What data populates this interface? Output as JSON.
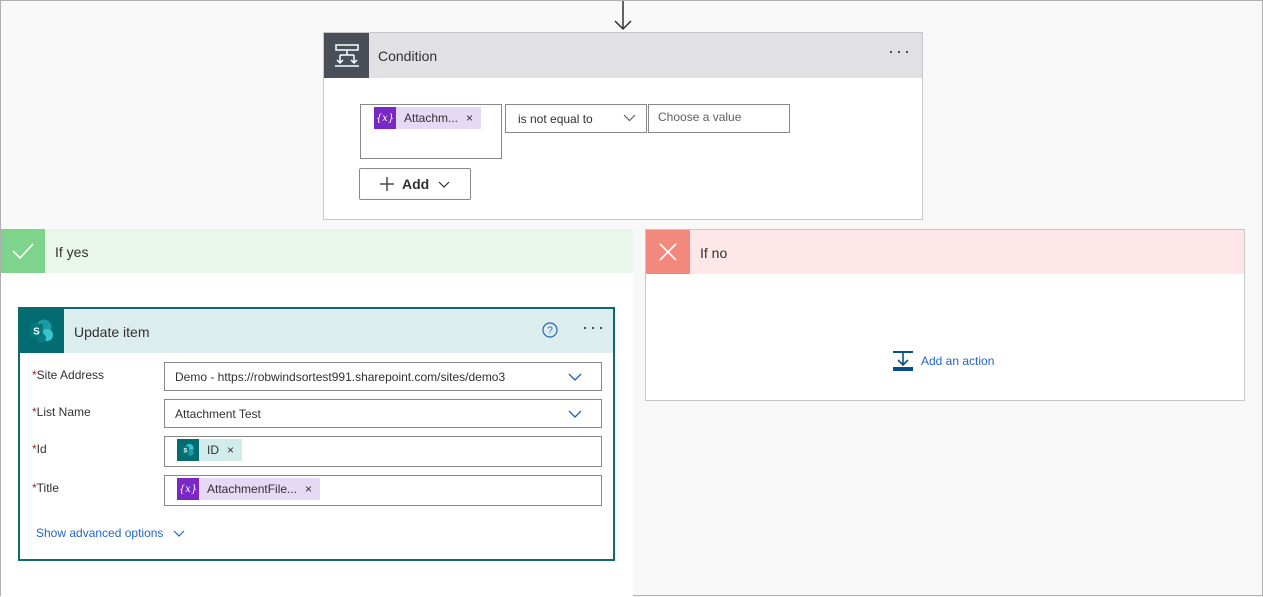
{
  "condition": {
    "title": "Condition",
    "more_label": "···",
    "left_token": {
      "label": "Attachm...",
      "remove": "×",
      "icon_text": "{x}"
    },
    "operator": "is not equal to",
    "value_placeholder": "Choose a value",
    "add_label": "Add"
  },
  "yes_branch": {
    "title": "If yes"
  },
  "no_branch": {
    "title": "If no",
    "add_action_label": "Add an action"
  },
  "update_item": {
    "title": "Update item",
    "more_label": "···",
    "fields": {
      "site_address": {
        "label": "Site Address",
        "required": "*",
        "value": "Demo - https://robwindsortest991.sharepoint.com/sites/demo3"
      },
      "list_name": {
        "label": "List Name",
        "required": "*",
        "value": "Attachment Test"
      },
      "id": {
        "label": "Id",
        "required": "*",
        "token": "ID",
        "remove": "×"
      },
      "title": {
        "label": "Title",
        "required": "*",
        "token": "AttachmentFile...",
        "remove": "×",
        "icon_text": "{x}"
      }
    },
    "show_advanced_label": "Show advanced options"
  },
  "colors": {
    "condition_icon_bg": "#484f58",
    "yes_accent": "#7ed48d",
    "no_accent": "#f3897d",
    "sharepoint_teal": "#036c70",
    "variable_purple": "#7a27c6",
    "link_blue": "#2566c4"
  }
}
